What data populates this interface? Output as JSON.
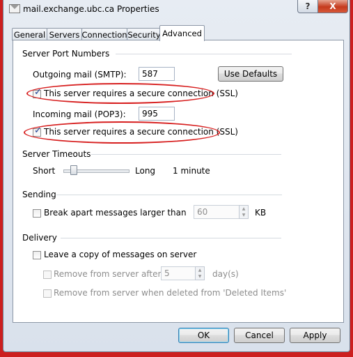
{
  "window": {
    "title": "mail.exchange.ubc.ca Properties",
    "help": "?",
    "close": "X"
  },
  "tabs": [
    {
      "label": "General"
    },
    {
      "label": "Servers"
    },
    {
      "label": "Connection"
    },
    {
      "label": "Security"
    },
    {
      "label": "Advanced",
      "active": true
    }
  ],
  "ports": {
    "group": "Server Port Numbers",
    "outgoing_label": "Outgoing mail (SMTP):",
    "outgoing_value": "587",
    "use_defaults": "Use Defaults",
    "outgoing_ssl_label": "This server requires a secure connection (SSL)",
    "outgoing_ssl_checked": true,
    "incoming_label": "Incoming mail (POP3):",
    "incoming_value": "995",
    "incoming_ssl_label": "This server requires a secure connection (SSL)",
    "incoming_ssl_checked": true
  },
  "timeouts": {
    "group": "Server Timeouts",
    "short": "Short",
    "long": "Long",
    "value": "1 minute",
    "slider_level": 0.1
  },
  "sending": {
    "group": "Sending",
    "break_label": "Break apart messages larger than",
    "break_checked": false,
    "size_value": "60",
    "unit": "KB"
  },
  "delivery": {
    "group": "Delivery",
    "leave_copy_label": "Leave a copy of messages on server",
    "leave_copy_checked": false,
    "remove_after_label": "Remove from server after",
    "remove_days_value": "5",
    "days_unit": "day(s)",
    "remove_deleted_label": "Remove from server when deleted from 'Deleted Items'"
  },
  "buttons": {
    "ok": "OK",
    "cancel": "Cancel",
    "apply": "Apply"
  },
  "colors": {
    "highlight_ellipse": "#d71f1f",
    "background": "#cc1f1f",
    "checkmark": "#1c3f94"
  }
}
